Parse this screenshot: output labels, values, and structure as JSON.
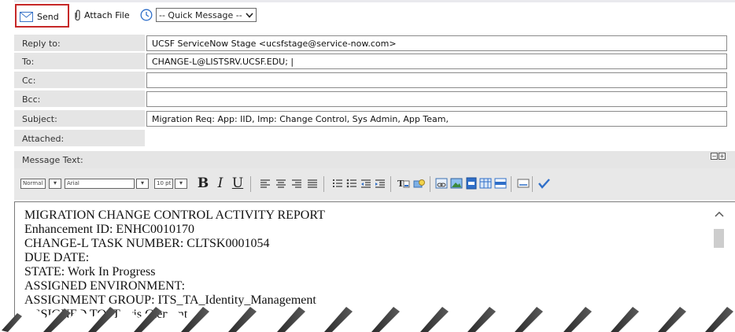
{
  "toolbar": {
    "send_label": "Send",
    "attach_label": "Attach File",
    "quick_message": {
      "selected": "-- Quick Message --",
      "icon": "clock-icon"
    },
    "icons": {
      "send": "envelope-icon",
      "attach": "paperclip-icon"
    },
    "highlight_color": "#c62828"
  },
  "fields": {
    "reply_to": {
      "label": "Reply to:",
      "value": "UCSF ServiceNow Stage <ucsfstage@service-now.com>"
    },
    "to": {
      "label": "To:",
      "value": "CHANGE-L@LISTSRV.UCSF.EDU; |"
    },
    "cc": {
      "label": "Cc:",
      "value": ""
    },
    "bcc": {
      "label": "Bcc:",
      "value": ""
    },
    "subject": {
      "label": "Subject:",
      "value": "Migration Req:  App: IID, Imp: Change Control, Sys Admin, App Team,"
    },
    "attached": {
      "label": "Attached:"
    }
  },
  "message": {
    "label": "Message Text:",
    "toggle": [
      "−",
      "+"
    ]
  },
  "editor_toolbar": {
    "format_select": "Normal",
    "font_select": "Arial",
    "size_select": "10 pt",
    "bold": "B",
    "italic": "I",
    "underline": "U",
    "buttons": [
      "align-left-icon",
      "align-center-icon",
      "align-right-icon",
      "justify-icon",
      "ordered-list-icon",
      "bullet-list-icon",
      "outdent-icon",
      "indent-icon",
      "font-color-icon",
      "highlight-icon",
      "link-icon",
      "image-icon",
      "table-icon",
      "table-grid-icon",
      "horizontal-rule-icon",
      "html-source-icon",
      "spellcheck-icon"
    ]
  },
  "editor": {
    "lines": [
      "MIGRATION CHANGE CONTROL ACTIVITY REPORT",
      "Enhancement ID: ENHC0010170",
      "CHANGE-L TASK NUMBER: CLTSK0001054",
      "DUE DATE:",
      "STATE: Work In Progress",
      "ASSIGNED ENVIRONMENT:",
      "ASSIGNMENT GROUP: ITS_TA_Identity_Management",
      "ASSIGNED TO: Terris Clement"
    ]
  }
}
